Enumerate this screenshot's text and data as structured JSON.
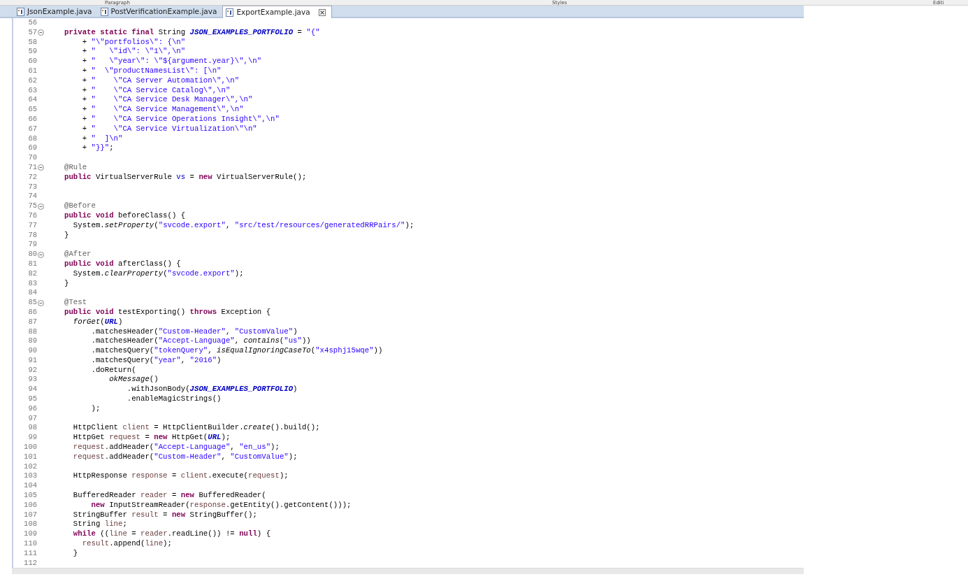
{
  "ribbon_labels": [
    "Paragraph",
    "Styles",
    "Editi"
  ],
  "tabs": [
    {
      "label": "JsonExample.java",
      "selected": false
    },
    {
      "label": "PostVerificationExample.java",
      "selected": false
    },
    {
      "label": "ExportExample.java",
      "selected": true
    }
  ],
  "editor": {
    "lines": [
      {
        "number": "56",
        "fold": false
      },
      {
        "number": "57",
        "fold": true,
        "tokens": [
          {
            "kind": "keyword",
            "text": "private static final"
          },
          {
            "kind": "plain",
            "text": " String "
          },
          {
            "kind": "constant",
            "text": "JSON_EXAMPLES_PORTFOLIO"
          },
          {
            "kind": "plain",
            "text": " = "
          },
          {
            "kind": "string",
            "text": "\"{\""
          }
        ]
      },
      {
        "number": "58",
        "fold": false,
        "tokens": [
          {
            "kind": "plain",
            "text": "    + "
          },
          {
            "kind": "string",
            "text": "\"\\\"portfolios\\\": {\\n\""
          }
        ]
      },
      {
        "number": "59",
        "fold": false,
        "tokens": [
          {
            "kind": "plain",
            "text": "    + "
          },
          {
            "kind": "string",
            "text": "\"   \\\"id\\\": \\\"1\\\",\\n\""
          }
        ]
      },
      {
        "number": "60",
        "fold": false,
        "tokens": [
          {
            "kind": "plain",
            "text": "    + "
          },
          {
            "kind": "string",
            "text": "\"   \\\"year\\\": \\\"${argument.year}\\\",\\n\""
          }
        ]
      },
      {
        "number": "61",
        "fold": false,
        "tokens": [
          {
            "kind": "plain",
            "text": "    + "
          },
          {
            "kind": "string",
            "text": "\"  \\\"productNamesList\\\": [\\n\""
          }
        ]
      },
      {
        "number": "62",
        "fold": false,
        "tokens": [
          {
            "kind": "plain",
            "text": "    + "
          },
          {
            "kind": "string",
            "text": "\"    \\\"CA Server Automation\\\",\\n\""
          }
        ]
      },
      {
        "number": "63",
        "fold": false,
        "tokens": [
          {
            "kind": "plain",
            "text": "    + "
          },
          {
            "kind": "string",
            "text": "\"    \\\"CA Service Catalog\\\",\\n\""
          }
        ]
      },
      {
        "number": "64",
        "fold": false,
        "tokens": [
          {
            "kind": "plain",
            "text": "    + "
          },
          {
            "kind": "string",
            "text": "\"    \\\"CA Service Desk Manager\\\",\\n\""
          }
        ]
      },
      {
        "number": "65",
        "fold": false,
        "tokens": [
          {
            "kind": "plain",
            "text": "    + "
          },
          {
            "kind": "string",
            "text": "\"    \\\"CA Service Management\\\",\\n\""
          }
        ]
      },
      {
        "number": "66",
        "fold": false,
        "tokens": [
          {
            "kind": "plain",
            "text": "    + "
          },
          {
            "kind": "string",
            "text": "\"    \\\"CA Service Operations Insight\\\",\\n\""
          }
        ]
      },
      {
        "number": "67",
        "fold": false,
        "tokens": [
          {
            "kind": "plain",
            "text": "    + "
          },
          {
            "kind": "string",
            "text": "\"    \\\"CA Service Virtualization\\\"\\n\""
          }
        ]
      },
      {
        "number": "68",
        "fold": false,
        "tokens": [
          {
            "kind": "plain",
            "text": "    + "
          },
          {
            "kind": "string",
            "text": "\"  ]\\n\""
          }
        ]
      },
      {
        "number": "69",
        "fold": false,
        "tokens": [
          {
            "kind": "plain",
            "text": "    + "
          },
          {
            "kind": "string",
            "text": "\"}}\""
          },
          {
            "kind": "plain",
            "text": ";"
          }
        ]
      },
      {
        "number": "70",
        "fold": false
      },
      {
        "number": "71",
        "fold": true,
        "tokens": [
          {
            "kind": "annotation",
            "text": "@Rule"
          }
        ]
      },
      {
        "number": "72",
        "fold": false,
        "tokens": [
          {
            "kind": "keyword",
            "text": "public"
          },
          {
            "kind": "plain",
            "text": " VirtualServerRule "
          },
          {
            "kind": "field",
            "text": "vs"
          },
          {
            "kind": "plain",
            "text": " = "
          },
          {
            "kind": "keyword",
            "text": "new"
          },
          {
            "kind": "plain",
            "text": " VirtualServerRule();"
          }
        ]
      },
      {
        "number": "73",
        "fold": false
      },
      {
        "number": "74",
        "fold": false
      },
      {
        "number": "75",
        "fold": true,
        "tokens": [
          {
            "kind": "annotation",
            "text": "@Before"
          }
        ]
      },
      {
        "number": "76",
        "fold": false,
        "tokens": [
          {
            "kind": "keyword",
            "text": "public void"
          },
          {
            "kind": "plain",
            "text": " beforeClass() {"
          }
        ]
      },
      {
        "number": "77",
        "fold": false,
        "tokens": [
          {
            "kind": "plain",
            "text": "  System."
          },
          {
            "kind": "static_method",
            "text": "setProperty"
          },
          {
            "kind": "plain",
            "text": "("
          },
          {
            "kind": "string",
            "text": "\"svcode.export\""
          },
          {
            "kind": "plain",
            "text": ", "
          },
          {
            "kind": "string",
            "text": "\"src/test/resources/generatedRRPairs/\""
          },
          {
            "kind": "plain",
            "text": ");"
          }
        ]
      },
      {
        "number": "78",
        "fold": false,
        "tokens": [
          {
            "kind": "plain",
            "text": "}"
          }
        ]
      },
      {
        "number": "79",
        "fold": false
      },
      {
        "number": "80",
        "fold": true,
        "tokens": [
          {
            "kind": "annotation",
            "text": "@After"
          }
        ]
      },
      {
        "number": "81",
        "fold": false,
        "tokens": [
          {
            "kind": "keyword",
            "text": "public void"
          },
          {
            "kind": "plain",
            "text": " afterClass() {"
          }
        ]
      },
      {
        "number": "82",
        "fold": false,
        "tokens": [
          {
            "kind": "plain",
            "text": "  System."
          },
          {
            "kind": "static_method",
            "text": "clearProperty"
          },
          {
            "kind": "plain",
            "text": "("
          },
          {
            "kind": "string",
            "text": "\"svcode.export\""
          },
          {
            "kind": "plain",
            "text": ");"
          }
        ]
      },
      {
        "number": "83",
        "fold": false,
        "tokens": [
          {
            "kind": "plain",
            "text": "}"
          }
        ]
      },
      {
        "number": "84",
        "fold": false
      },
      {
        "number": "85",
        "fold": true,
        "tokens": [
          {
            "kind": "annotation",
            "text": "@Test"
          }
        ]
      },
      {
        "number": "86",
        "fold": false,
        "tokens": [
          {
            "kind": "keyword",
            "text": "public void"
          },
          {
            "kind": "plain",
            "text": " testExporting() "
          },
          {
            "kind": "keyword",
            "text": "throws"
          },
          {
            "kind": "plain",
            "text": " Exception {"
          }
        ]
      },
      {
        "number": "87",
        "fold": false,
        "tokens": [
          {
            "kind": "static_method",
            "text": "  forGet"
          },
          {
            "kind": "plain",
            "text": "("
          },
          {
            "kind": "constant",
            "text": "URL"
          },
          {
            "kind": "plain",
            "text": ")"
          }
        ]
      },
      {
        "number": "88",
        "fold": false,
        "tokens": [
          {
            "kind": "plain",
            "text": "      .matchesHeader("
          },
          {
            "kind": "string",
            "text": "\"Custom-Header\""
          },
          {
            "kind": "plain",
            "text": ", "
          },
          {
            "kind": "string",
            "text": "\"CustomValue\""
          },
          {
            "kind": "plain",
            "text": ")"
          }
        ]
      },
      {
        "number": "89",
        "fold": false,
        "tokens": [
          {
            "kind": "plain",
            "text": "      .matchesHeader("
          },
          {
            "kind": "string",
            "text": "\"Accept-Language\""
          },
          {
            "kind": "plain",
            "text": ", "
          },
          {
            "kind": "static_method",
            "text": "contains"
          },
          {
            "kind": "plain",
            "text": "("
          },
          {
            "kind": "string",
            "text": "\"us\""
          },
          {
            "kind": "plain",
            "text": "))"
          }
        ]
      },
      {
        "number": "90",
        "fold": false,
        "tokens": [
          {
            "kind": "plain",
            "text": "      .matchesQuery("
          },
          {
            "kind": "string",
            "text": "\"tokenQuery\""
          },
          {
            "kind": "plain",
            "text": ", "
          },
          {
            "kind": "static_method",
            "text": "isEqualIgnoringCaseTo"
          },
          {
            "kind": "plain",
            "text": "("
          },
          {
            "kind": "string",
            "text": "\"x4sphj15wqe\""
          },
          {
            "kind": "plain",
            "text": "))"
          }
        ]
      },
      {
        "number": "91",
        "fold": false,
        "tokens": [
          {
            "kind": "plain",
            "text": "      .matchesQuery("
          },
          {
            "kind": "string",
            "text": "\"year\""
          },
          {
            "kind": "plain",
            "text": ", "
          },
          {
            "kind": "string",
            "text": "\"2016\""
          },
          {
            "kind": "plain",
            "text": ")"
          }
        ]
      },
      {
        "number": "92",
        "fold": false,
        "tokens": [
          {
            "kind": "plain",
            "text": "      .doReturn("
          }
        ]
      },
      {
        "number": "93",
        "fold": false,
        "tokens": [
          {
            "kind": "static_method",
            "text": "          okMessage"
          },
          {
            "kind": "plain",
            "text": "()"
          }
        ]
      },
      {
        "number": "94",
        "fold": false,
        "tokens": [
          {
            "kind": "plain",
            "text": "              .withJsonBody("
          },
          {
            "kind": "constant",
            "text": "JSON_EXAMPLES_PORTFOLIO"
          },
          {
            "kind": "plain",
            "text": ")"
          }
        ]
      },
      {
        "number": "95",
        "fold": false,
        "tokens": [
          {
            "kind": "plain",
            "text": "              .enableMagicStrings()"
          }
        ]
      },
      {
        "number": "96",
        "fold": false,
        "tokens": [
          {
            "kind": "plain",
            "text": "      );"
          }
        ]
      },
      {
        "number": "97",
        "fold": false
      },
      {
        "number": "98",
        "fold": false,
        "tokens": [
          {
            "kind": "plain",
            "text": "  HttpClient "
          },
          {
            "kind": "local",
            "text": "client"
          },
          {
            "kind": "plain",
            "text": " = HttpClientBuilder."
          },
          {
            "kind": "static_method",
            "text": "create"
          },
          {
            "kind": "plain",
            "text": "().build();"
          }
        ]
      },
      {
        "number": "99",
        "fold": false,
        "tokens": [
          {
            "kind": "plain",
            "text": "  HttpGet "
          },
          {
            "kind": "local",
            "text": "request"
          },
          {
            "kind": "plain",
            "text": " = "
          },
          {
            "kind": "keyword",
            "text": "new"
          },
          {
            "kind": "plain",
            "text": " HttpGet("
          },
          {
            "kind": "constant",
            "text": "URL"
          },
          {
            "kind": "plain",
            "text": ");"
          }
        ]
      },
      {
        "number": "100",
        "fold": false,
        "tokens": [
          {
            "kind": "local",
            "text": "  request"
          },
          {
            "kind": "plain",
            "text": ".addHeader("
          },
          {
            "kind": "string",
            "text": "\"Accept-Language\""
          },
          {
            "kind": "plain",
            "text": ", "
          },
          {
            "kind": "string",
            "text": "\"en_us\""
          },
          {
            "kind": "plain",
            "text": ");"
          }
        ]
      },
      {
        "number": "101",
        "fold": false,
        "tokens": [
          {
            "kind": "local",
            "text": "  request"
          },
          {
            "kind": "plain",
            "text": ".addHeader("
          },
          {
            "kind": "string",
            "text": "\"Custom-Header\""
          },
          {
            "kind": "plain",
            "text": ", "
          },
          {
            "kind": "string",
            "text": "\"CustomValue\""
          },
          {
            "kind": "plain",
            "text": ");"
          }
        ]
      },
      {
        "number": "102",
        "fold": false
      },
      {
        "number": "103",
        "fold": false,
        "tokens": [
          {
            "kind": "plain",
            "text": "  HttpResponse "
          },
          {
            "kind": "local",
            "text": "response"
          },
          {
            "kind": "plain",
            "text": " = "
          },
          {
            "kind": "local",
            "text": "client"
          },
          {
            "kind": "plain",
            "text": ".execute("
          },
          {
            "kind": "local",
            "text": "request"
          },
          {
            "kind": "plain",
            "text": ");"
          }
        ]
      },
      {
        "number": "104",
        "fold": false
      },
      {
        "number": "105",
        "fold": false,
        "tokens": [
          {
            "kind": "plain",
            "text": "  BufferedReader "
          },
          {
            "kind": "local",
            "text": "reader"
          },
          {
            "kind": "plain",
            "text": " = "
          },
          {
            "kind": "keyword",
            "text": "new"
          },
          {
            "kind": "plain",
            "text": " BufferedReader("
          }
        ]
      },
      {
        "number": "106",
        "fold": false,
        "tokens": [
          {
            "kind": "keyword",
            "text": "      new"
          },
          {
            "kind": "plain",
            "text": " InputStreamReader("
          },
          {
            "kind": "local",
            "text": "response"
          },
          {
            "kind": "plain",
            "text": ".getEntity().getContent()));"
          }
        ]
      },
      {
        "number": "107",
        "fold": false,
        "tokens": [
          {
            "kind": "plain",
            "text": "  StringBuffer "
          },
          {
            "kind": "local",
            "text": "result"
          },
          {
            "kind": "plain",
            "text": " = "
          },
          {
            "kind": "keyword",
            "text": "new"
          },
          {
            "kind": "plain",
            "text": " StringBuffer();"
          }
        ]
      },
      {
        "number": "108",
        "fold": false,
        "tokens": [
          {
            "kind": "plain",
            "text": "  String "
          },
          {
            "kind": "local",
            "text": "line"
          },
          {
            "kind": "plain",
            "text": ";"
          }
        ]
      },
      {
        "number": "109",
        "fold": false,
        "tokens": [
          {
            "kind": "keyword",
            "text": "  while"
          },
          {
            "kind": "plain",
            "text": " (("
          },
          {
            "kind": "local",
            "text": "line"
          },
          {
            "kind": "plain",
            "text": " = "
          },
          {
            "kind": "local",
            "text": "reader"
          },
          {
            "kind": "plain",
            "text": ".readLine()) != "
          },
          {
            "kind": "keyword",
            "text": "null"
          },
          {
            "kind": "plain",
            "text": ") {"
          }
        ]
      },
      {
        "number": "110",
        "fold": false,
        "tokens": [
          {
            "kind": "local",
            "text": "    result"
          },
          {
            "kind": "plain",
            "text": ".append("
          },
          {
            "kind": "local",
            "text": "line"
          },
          {
            "kind": "plain",
            "text": ");"
          }
        ]
      },
      {
        "number": "111",
        "fold": false,
        "tokens": [
          {
            "kind": "plain",
            "text": "  }"
          }
        ]
      },
      {
        "number": "112",
        "fold": false
      }
    ]
  }
}
